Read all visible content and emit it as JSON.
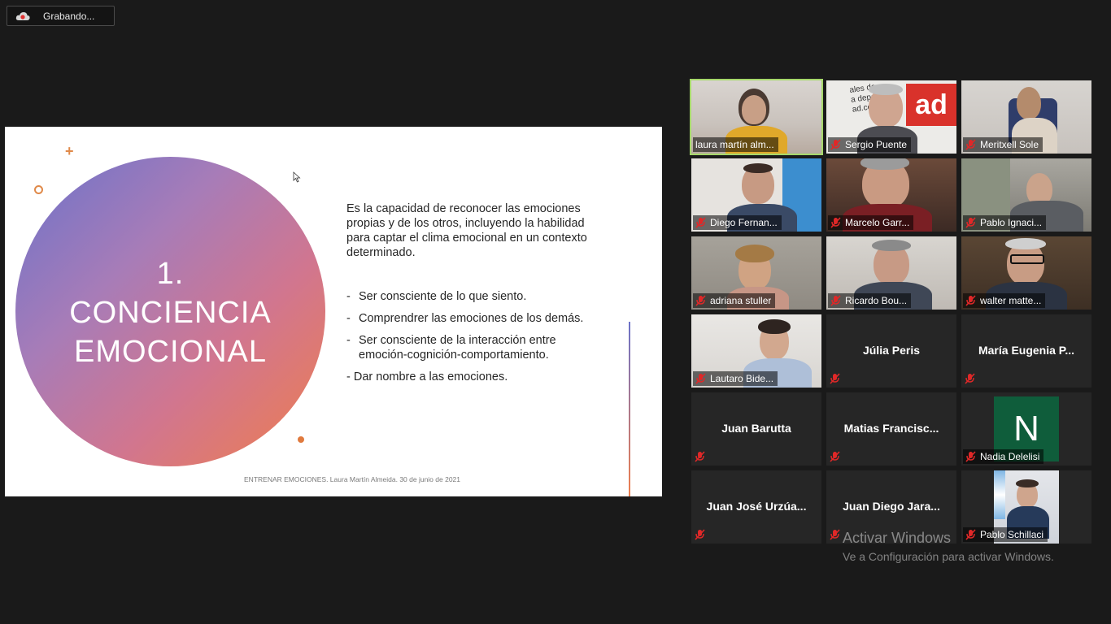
{
  "recording": {
    "label": "Grabando..."
  },
  "slide": {
    "title_line1": "1.",
    "title_line2": "CONCIENCIA",
    "title_line3": "EMOCIONAL",
    "paragraph": "Es la capacidad de reconocer las emociones propias y de los otros, incluyendo la habilidad para captar el clima emocional en un contexto determinado.",
    "bullets": [
      "Ser consciente de lo que siento.",
      "Comprendrer las emociones de los demás.",
      "Ser consciente de la interacción entre emoción-cognición-comportamiento."
    ],
    "last_item": "- Dar nombre a las emociones.",
    "footer": "ENTRENAR EMOCIONES. Laura Martín Almeida. 30 de junio de 2021"
  },
  "participants": [
    {
      "name": "laura martín alm...",
      "video": true,
      "muted": false,
      "active": true
    },
    {
      "name": "Sergio Puente",
      "video": true,
      "muted": true
    },
    {
      "name": "Meritxell Sole",
      "video": true,
      "muted": true
    },
    {
      "name": "Diego Fernan...",
      "video": true,
      "muted": true
    },
    {
      "name": "Marcelo Garr...",
      "video": true,
      "muted": true
    },
    {
      "name": "Pablo Ignaci...",
      "video": true,
      "muted": true
    },
    {
      "name": "adriana stuller",
      "video": true,
      "muted": true
    },
    {
      "name": "Ricardo Bou...",
      "video": true,
      "muted": true
    },
    {
      "name": "walter matte...",
      "video": true,
      "muted": true
    },
    {
      "name": "Lautaro Bide...",
      "video": true,
      "muted": true
    },
    {
      "name": "Júlia Peris",
      "video": false,
      "muted": true
    },
    {
      "name": "María Eugenia P...",
      "video": false,
      "muted": true
    },
    {
      "name": "Juan Barutta",
      "video": false,
      "muted": true
    },
    {
      "name": "Matias Francisc...",
      "video": false,
      "muted": true
    },
    {
      "name": "Nadia Delelisi",
      "video": false,
      "muted": true,
      "avatar_letter": "N",
      "avatar_color": "#0f5d3b"
    },
    {
      "name": "Juan José Urzúa...",
      "video": false,
      "muted": true
    },
    {
      "name": "Juan Diego Jara...",
      "video": false,
      "muted": true
    },
    {
      "name": "Pablo Schillaci",
      "video": true,
      "muted": true
    }
  ],
  "sergio_backdrop_text": [
    "ales de",
    "a deportiv",
    "ad.com"
  ],
  "watermark": {
    "title": "Activar Windows",
    "subtitle": "Ve a Configuración para activar Windows."
  },
  "colors": {
    "background": "#1a1a1a",
    "tile": "#262626",
    "active_border": "#a6d86b",
    "mute_red": "#e02828"
  }
}
